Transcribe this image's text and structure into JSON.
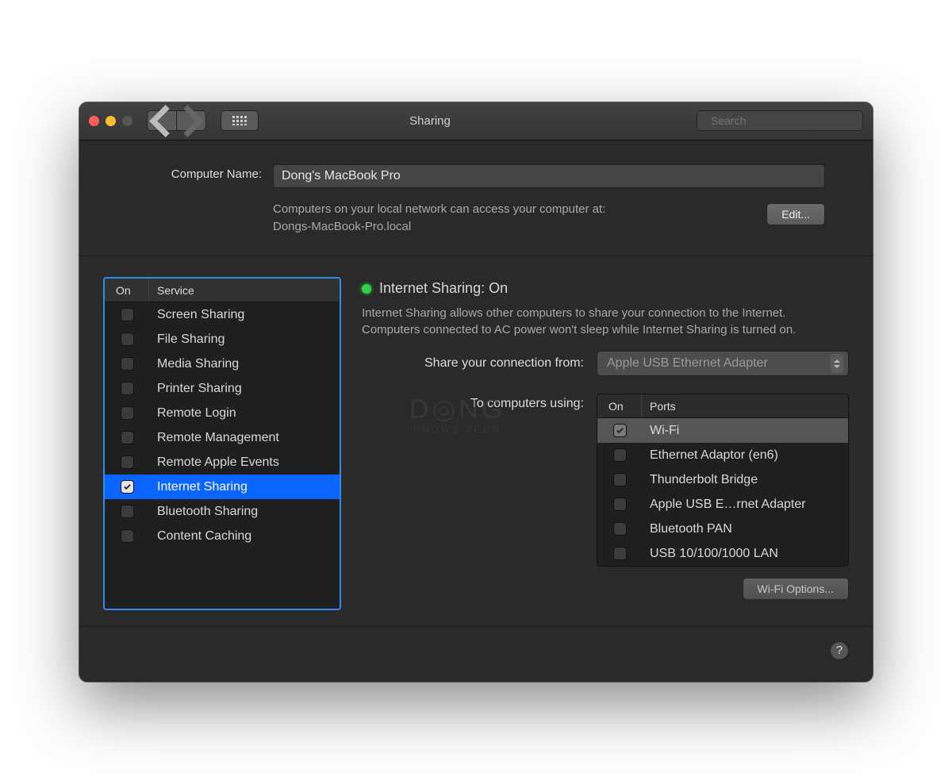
{
  "window": {
    "title": "Sharing"
  },
  "toolbar": {
    "search_placeholder": "Search"
  },
  "computer": {
    "label": "Computer Name:",
    "value": "Dong's MacBook Pro",
    "access_text": "Computers on your local network can access your computer at:",
    "hostname": "Dongs-MacBook-Pro.local",
    "edit_label": "Edit..."
  },
  "services": {
    "head_on": "On",
    "head_service": "Service",
    "items": [
      {
        "on": false,
        "label": "Screen Sharing"
      },
      {
        "on": false,
        "label": "File Sharing"
      },
      {
        "on": false,
        "label": "Media Sharing"
      },
      {
        "on": false,
        "label": "Printer Sharing"
      },
      {
        "on": false,
        "label": "Remote Login"
      },
      {
        "on": false,
        "label": "Remote Management"
      },
      {
        "on": false,
        "label": "Remote Apple Events"
      },
      {
        "on": true,
        "label": "Internet Sharing",
        "selected": true
      },
      {
        "on": false,
        "label": "Bluetooth Sharing"
      },
      {
        "on": false,
        "label": "Content Caching"
      }
    ]
  },
  "detail": {
    "status_title": "Internet Sharing: On",
    "status_color": "#2fd24b",
    "description": "Internet Sharing allows other computers to share your connection to the Internet. Computers connected to AC power won't sleep while Internet Sharing is turned on.",
    "share_from_label": "Share your connection from:",
    "share_from_value": "Apple USB Ethernet Adapter",
    "to_label": "To computers using:",
    "ports_head_on": "On",
    "ports_head_ports": "Ports",
    "ports": [
      {
        "on": true,
        "label": "Wi-Fi",
        "hl": true,
        "disabled": true
      },
      {
        "on": false,
        "label": "Ethernet Adaptor (en6)"
      },
      {
        "on": false,
        "label": "Thunderbolt Bridge"
      },
      {
        "on": false,
        "label": "Apple USB E…rnet Adapter"
      },
      {
        "on": false,
        "label": "Bluetooth PAN"
      },
      {
        "on": false,
        "label": "USB 10/100/1000 LAN"
      }
    ],
    "wifi_options_label": "Wi-Fi Options..."
  },
  "help_label": "?"
}
